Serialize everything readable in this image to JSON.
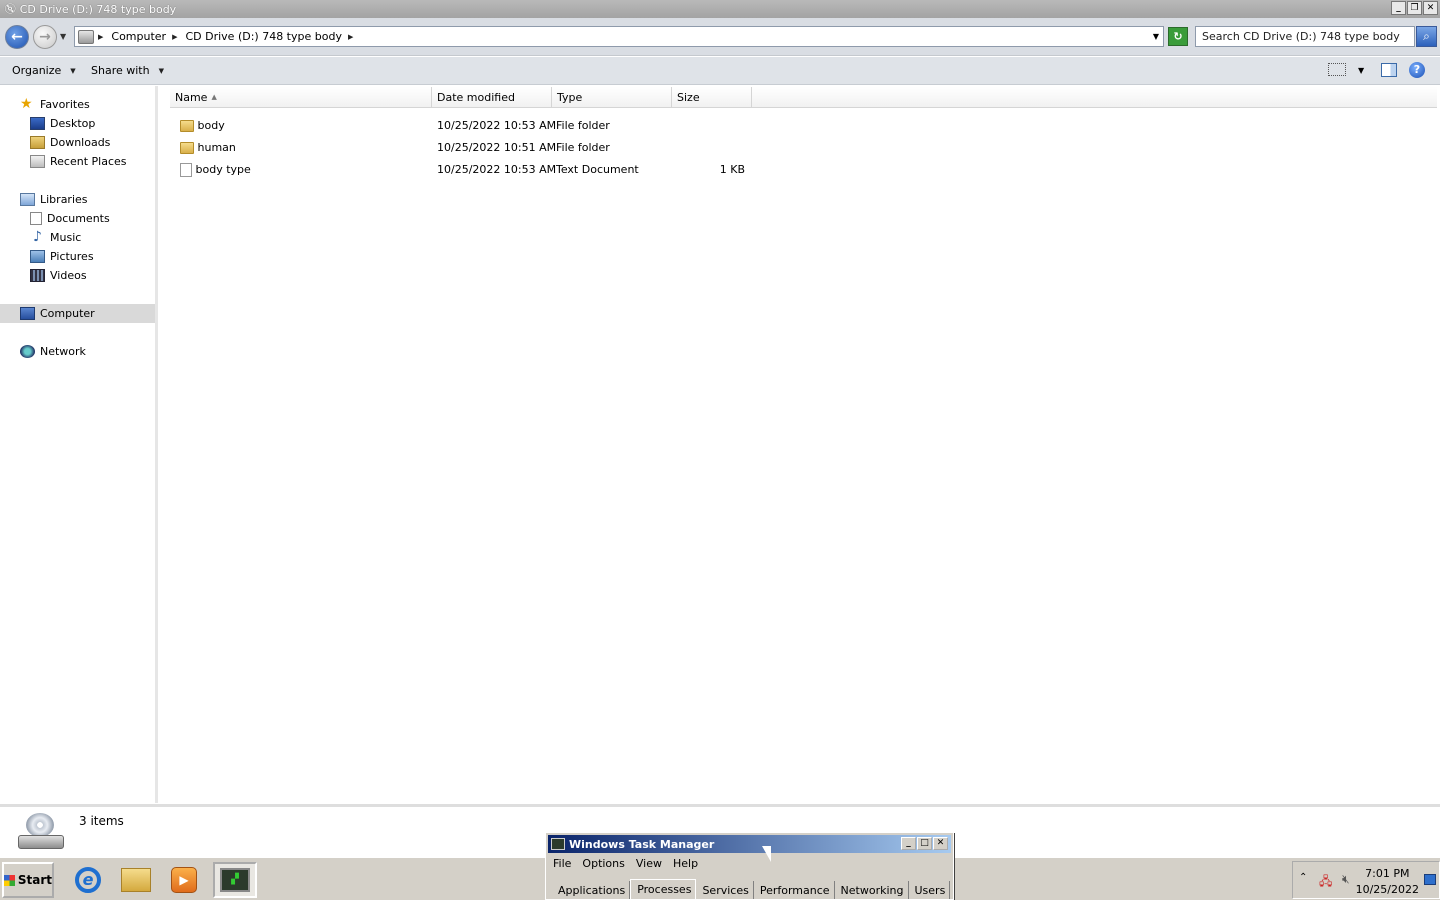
{
  "window": {
    "title": "CD Drive (D:) 748 type body"
  },
  "address": {
    "crumbs": [
      "Computer",
      "CD Drive (D:) 748 type body"
    ],
    "search_placeholder": "Search CD Drive (D:) 748 type body"
  },
  "toolbar": {
    "organize": "Organize",
    "share_with": "Share with"
  },
  "nav": {
    "favorites": "Favorites",
    "desktop": "Desktop",
    "downloads": "Downloads",
    "recent_places": "Recent Places",
    "libraries": "Libraries",
    "documents": "Documents",
    "music": "Music",
    "pictures": "Pictures",
    "videos": "Videos",
    "computer": "Computer",
    "network": "Network"
  },
  "columns": {
    "name": "Name",
    "date_modified": "Date modified",
    "type": "Type",
    "size": "Size"
  },
  "files": [
    {
      "name": "body",
      "date": "10/25/2022 10:53 AM",
      "type": "File folder",
      "size": "",
      "icon": "folder-icon"
    },
    {
      "name": "human",
      "date": "10/25/2022 10:51 AM",
      "type": "File folder",
      "size": "",
      "icon": "folder-icon"
    },
    {
      "name": "body type",
      "date": "10/25/2022 10:53 AM",
      "type": "Text Document",
      "size": "1 KB",
      "icon": "text-file-icon"
    }
  ],
  "details": {
    "item_count": "3 items"
  },
  "taskbar": {
    "start": "Start",
    "time": "7:01 PM",
    "date": "10/25/2022"
  },
  "task_manager": {
    "title": "Windows Task Manager",
    "menu": [
      "File",
      "Options",
      "View",
      "Help"
    ],
    "tabs": [
      "Applications",
      "Processes",
      "Services",
      "Performance",
      "Networking",
      "Users"
    ],
    "active_tab": "Processes"
  }
}
